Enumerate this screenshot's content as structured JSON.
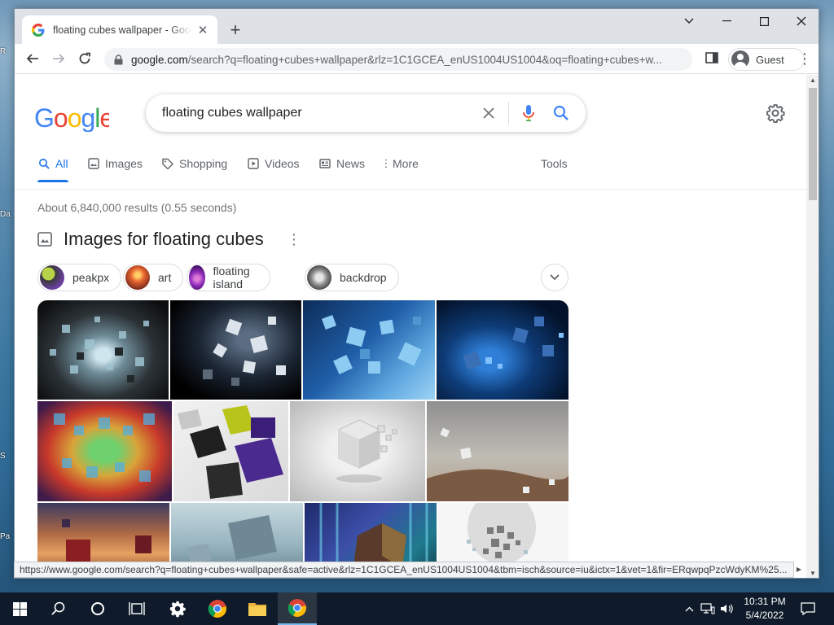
{
  "desktop": {
    "stubs": [
      "R",
      "Da",
      "S",
      "Pa"
    ]
  },
  "browser": {
    "tab_title": "floating cubes wallpaper - Google Search",
    "url_domain": "google.com",
    "url_rest": "/search?q=floating+cubes+wallpaper&rlz=1C1GCEA_enUS1004US1004&oq=floating+cubes+w...",
    "profile_name": "Guest",
    "status_url": "https://www.google.com/search?q=floating+cubes+wallpaper&safe=active&rlz=1C1GCEA_enUS1004US1004&tbm=isch&source=iu&ictx=1&vet=1&fir=ERqwpqPzcWdyKM%25..."
  },
  "google": {
    "query": "floating cubes wallpaper",
    "tabs": [
      {
        "label": "All",
        "icon": "search-icon"
      },
      {
        "label": "Images",
        "icon": "image-icon"
      },
      {
        "label": "Shopping",
        "icon": "tag-icon"
      },
      {
        "label": "Videos",
        "icon": "play-icon"
      },
      {
        "label": "News",
        "icon": "news-icon"
      },
      {
        "label": "More",
        "icon": "more-vert-icon"
      }
    ],
    "tools_label": "Tools",
    "result_stats": "About 6,840,000 results (0.55 seconds)",
    "images_header": "Images for floating cubes",
    "chips": [
      {
        "label": "peakpx"
      },
      {
        "label": "art"
      },
      {
        "label": "floating island"
      },
      {
        "label": "backdrop"
      }
    ]
  },
  "taskbar": {
    "time": "10:31 PM",
    "date": "5/4/2022"
  },
  "colors": {
    "google_blue": "#4285f4",
    "google_red": "#ea4335",
    "google_yellow": "#fbbc05",
    "google_green": "#34a853",
    "link_blue": "#1a73e8",
    "taskbar": "#0f1b2a"
  }
}
